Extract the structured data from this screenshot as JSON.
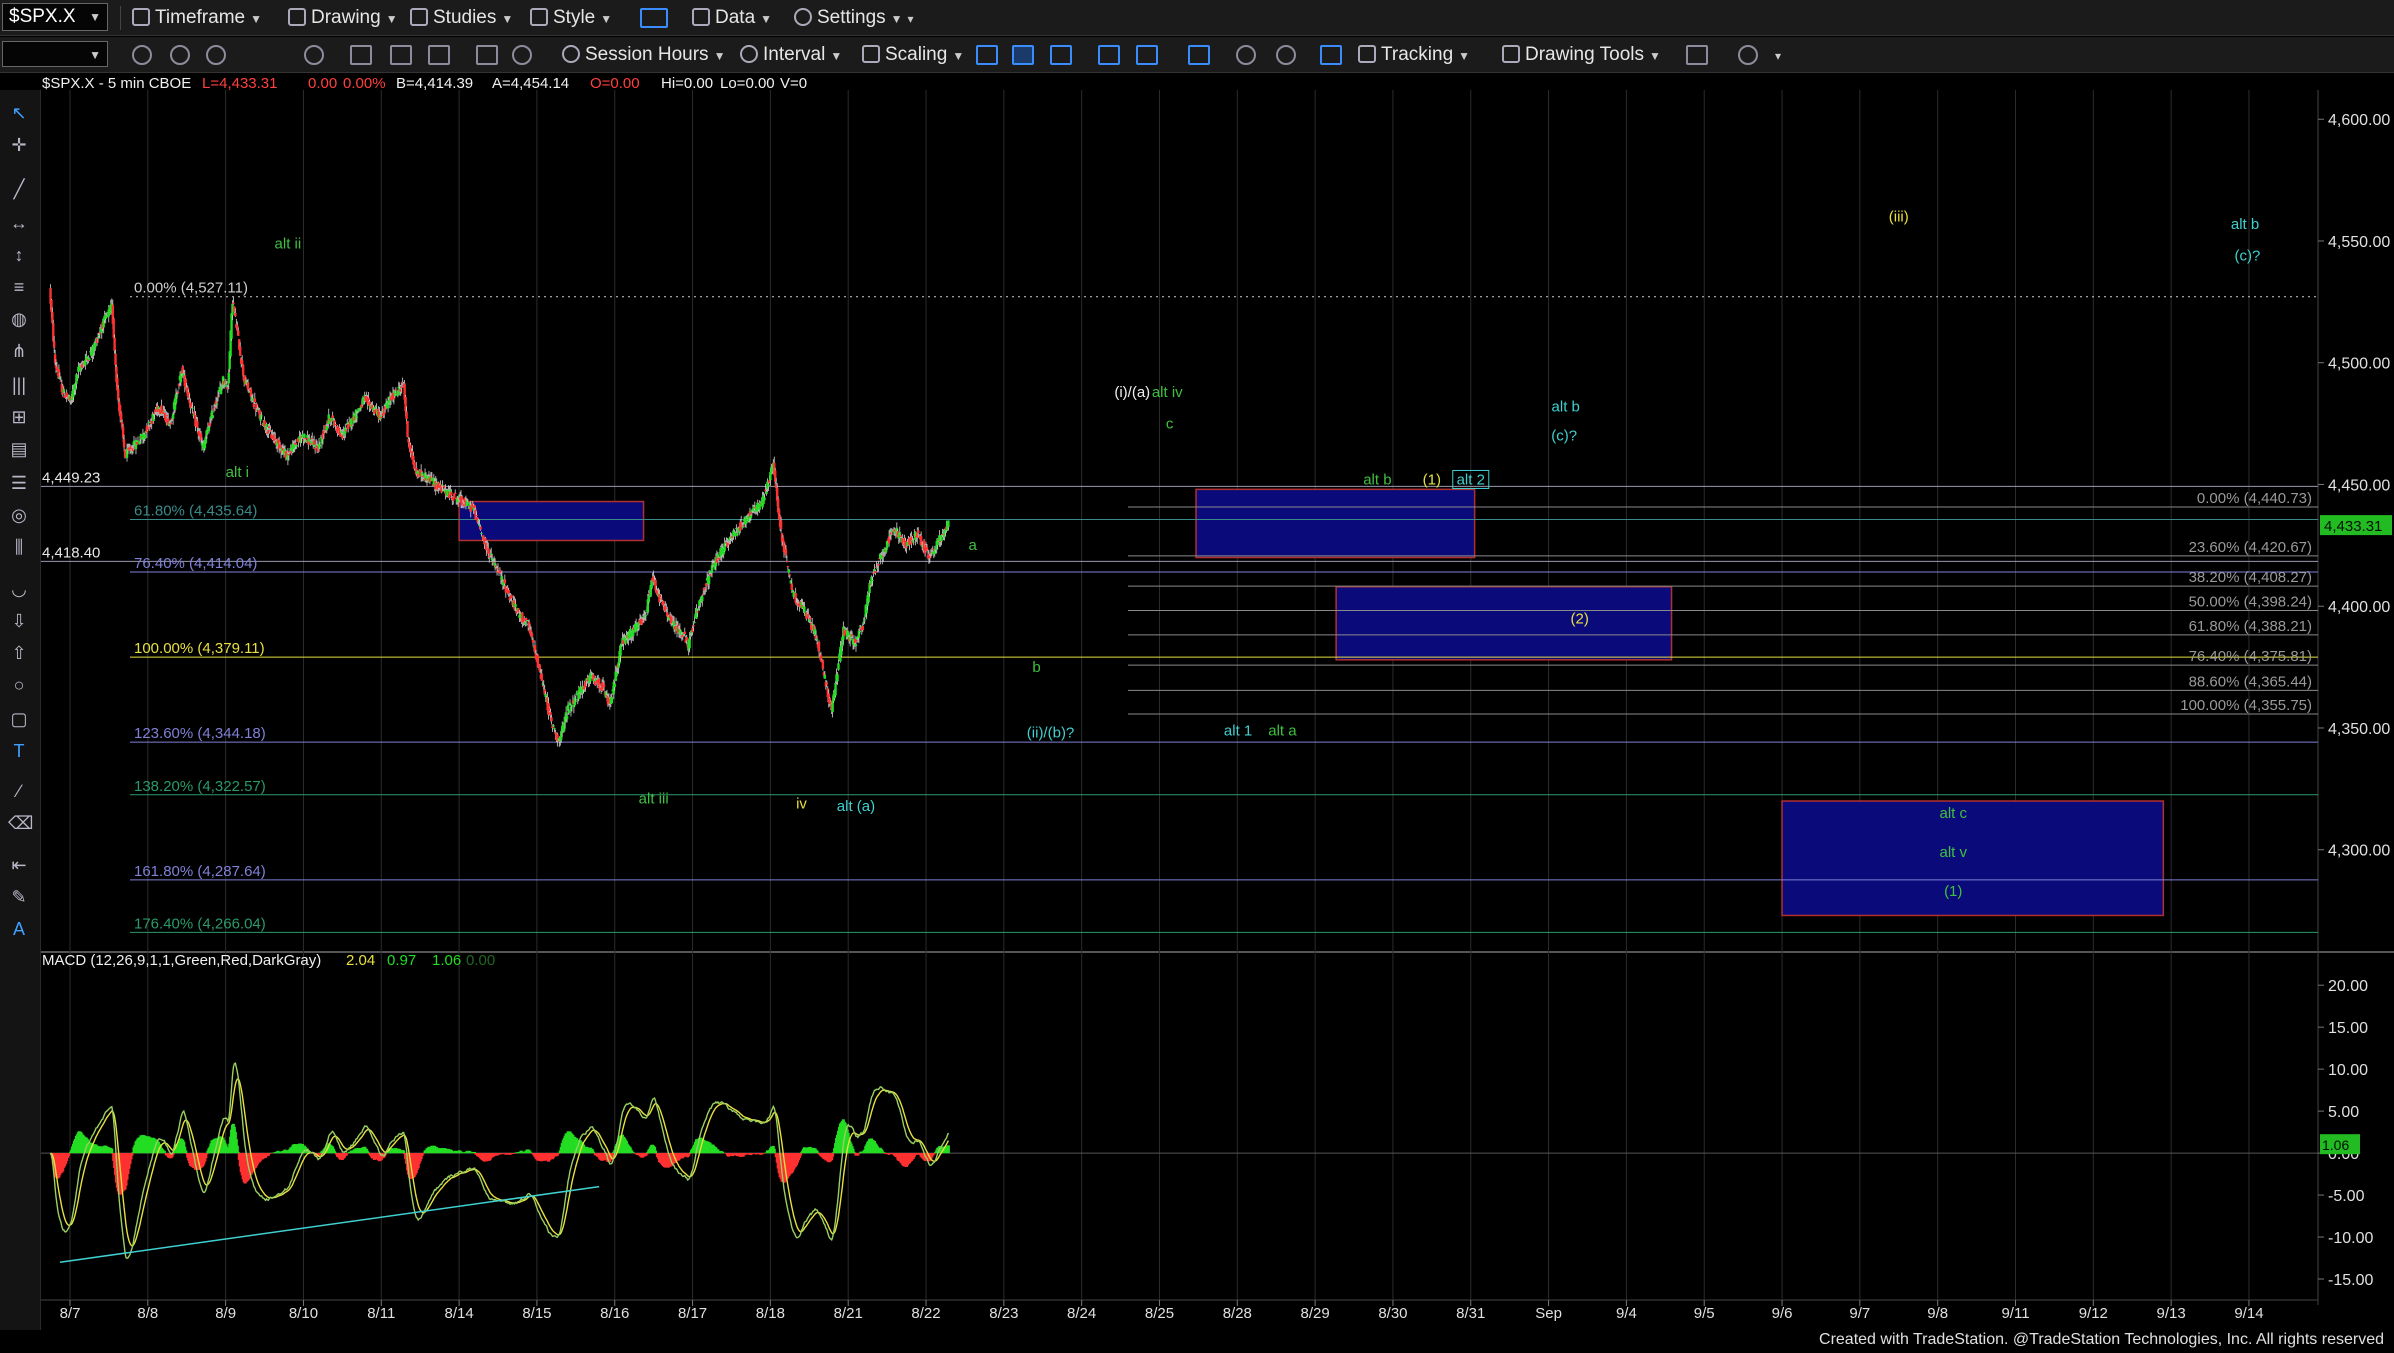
{
  "toolbar": {
    "symbol": "$SPX.X",
    "items": [
      "Timeframe",
      "Drawing",
      "Studies",
      "Style",
      "Data",
      "Settings"
    ],
    "row2": [
      "Session Hours",
      "Interval",
      "Scaling",
      "Tracking",
      "Drawing Tools"
    ]
  },
  "header": {
    "symbol_info": "$SPX.X - 5 min  CBOE",
    "low": "L=4,433.31",
    "change": "0.00",
    "change_pct": "0.00%",
    "bid": "B=4,414.39",
    "ask": "A=4,454.14",
    "open": "O=0.00",
    "hi": "Hi=0.00",
    "lo": "Lo=0.00",
    "vol": "V=0"
  },
  "macd": {
    "label": "MACD (12,26,9,1,1,Green,Red,DarkGray)",
    "v1": "2.04",
    "v2": "0.97",
    "v3": "1.06",
    "v4": "0.00"
  },
  "footer": "Created with TradeStation. @TradeStation Technologies, Inc. All rights reserved",
  "colors": {
    "background": "#000000",
    "up": "#22dd22",
    "down": "#ff3030",
    "wick": "#d8d8d8",
    "box_fill": "#0a0a7a",
    "box_edge": "#b03030",
    "green_label": "#40c040",
    "yellow_label": "#e8e040",
    "cyan_label": "#40d0d0",
    "white_label": "#f0f0f0"
  },
  "chart_data": {
    "type": "candlestick",
    "symbol": "$SPX.X",
    "interval": "5 min",
    "price_axis": {
      "ticks": [
        4600,
        4550,
        4500,
        4450,
        4400,
        4350,
        4300
      ],
      "tick_labels": [
        "4,600.00",
        "4,550.00",
        "4,500.00",
        "4,450.00",
        "4,400.00",
        "4,350.00",
        "4,300.00"
      ],
      "range": [
        4258,
        4612
      ],
      "last_price": "4,433.31"
    },
    "macd_axis": {
      "ticks": [
        20,
        15,
        10,
        5,
        0,
        -5,
        -10,
        -15
      ],
      "tick_labels": [
        "20.00",
        "15.00",
        "10.00",
        "5.00",
        "0.00",
        "-5.00",
        "-10.00",
        "-15.00"
      ],
      "range": [
        -17.5,
        23
      ],
      "last_value": "1.06"
    },
    "x_axis": {
      "labels": [
        "8/7",
        "8/8",
        "8/9",
        "8/10",
        "8/11",
        "8/14",
        "8/15",
        "8/16",
        "8/17",
        "8/18",
        "8/21",
        "8/22",
        "8/23",
        "8/24",
        "8/25",
        "8/28",
        "8/29",
        "8/30",
        "8/31",
        "Sep",
        "9/4",
        "9/5",
        "9/6",
        "9/7",
        "9/8",
        "9/11",
        "9/12",
        "9/13",
        "9/14"
      ],
      "session_index": [
        0,
        1,
        2,
        3,
        4,
        5,
        6,
        7,
        8,
        9,
        10,
        11,
        12,
        13,
        14,
        15,
        16,
        17,
        18,
        19,
        20,
        21,
        22,
        23,
        24,
        25,
        26,
        27,
        28
      ]
    },
    "price_path": [
      [
        -0.25,
        4530
      ],
      [
        -0.18,
        4500
      ],
      [
        -0.08,
        4488
      ],
      [
        0.02,
        4484
      ],
      [
        0.12,
        4497
      ],
      [
        0.3,
        4505
      ],
      [
        0.42,
        4515
      ],
      [
        0.55,
        4523
      ],
      [
        0.62,
        4488
      ],
      [
        0.72,
        4462
      ],
      [
        0.95,
        4470
      ],
      [
        1.15,
        4482
      ],
      [
        1.3,
        4475
      ],
      [
        1.45,
        4497
      ],
      [
        1.6,
        4478
      ],
      [
        1.72,
        4465
      ],
      [
        1.85,
        4480
      ],
      [
        1.98,
        4493
      ],
      [
        2.04,
        4490
      ],
      [
        2.1,
        4526
      ],
      [
        2.25,
        4493
      ],
      [
        2.45,
        4478
      ],
      [
        2.6,
        4470
      ],
      [
        2.8,
        4462
      ],
      [
        3.0,
        4470
      ],
      [
        3.2,
        4465
      ],
      [
        3.35,
        4478
      ],
      [
        3.5,
        4470
      ],
      [
        3.65,
        4477
      ],
      [
        3.8,
        4485
      ],
      [
        4.0,
        4478
      ],
      [
        4.15,
        4486
      ],
      [
        4.3,
        4491
      ],
      [
        4.35,
        4470
      ],
      [
        4.45,
        4455
      ],
      [
        4.6,
        4453
      ],
      [
        4.75,
        4449
      ],
      [
        4.9,
        4446
      ],
      [
        5.05,
        4443
      ],
      [
        5.2,
        4440
      ],
      [
        5.35,
        4425
      ],
      [
        5.5,
        4415
      ],
      [
        5.65,
        4405
      ],
      [
        5.75,
        4398
      ],
      [
        5.9,
        4392
      ],
      [
        6.0,
        4380
      ],
      [
        6.1,
        4366
      ],
      [
        6.2,
        4352
      ],
      [
        6.3,
        4344
      ],
      [
        6.4,
        4357
      ],
      [
        6.55,
        4364
      ],
      [
        6.7,
        4371
      ],
      [
        6.85,
        4367
      ],
      [
        6.95,
        4359
      ],
      [
        7.1,
        4385
      ],
      [
        7.25,
        4390
      ],
      [
        7.4,
        4395
      ],
      [
        7.5,
        4412
      ],
      [
        7.6,
        4402
      ],
      [
        7.75,
        4393
      ],
      [
        7.9,
        4388
      ],
      [
        7.95,
        4383
      ],
      [
        8.1,
        4402
      ],
      [
        8.3,
        4418
      ],
      [
        8.5,
        4428
      ],
      [
        8.7,
        4436
      ],
      [
        8.9,
        4442
      ],
      [
        9.05,
        4458
      ],
      [
        9.15,
        4430
      ],
      [
        9.3,
        4405
      ],
      [
        9.45,
        4398
      ],
      [
        9.6,
        4388
      ],
      [
        9.7,
        4372
      ],
      [
        9.8,
        4357
      ],
      [
        9.95,
        4390
      ],
      [
        10.1,
        4385
      ],
      [
        10.2,
        4392
      ],
      [
        10.3,
        4410
      ],
      [
        10.4,
        4418
      ],
      [
        10.5,
        4425
      ],
      [
        10.6,
        4432
      ],
      [
        10.75,
        4425
      ],
      [
        10.9,
        4430
      ],
      [
        11.05,
        4420
      ],
      [
        11.2,
        4428
      ],
      [
        11.3,
        4434
      ]
    ],
    "fib_left": [
      {
        "label": "0.00% (4,527.11)",
        "price": 4527.11,
        "color": "#cfcfcf",
        "dotted": true
      },
      {
        "label": "61.80% (4,435.64)",
        "price": 4435.64,
        "color": "#3a8a8a"
      },
      {
        "label": "76.40% (4,414.04)",
        "price": 4414.04,
        "color": "#8080d8"
      },
      {
        "label": "100.00% (4,379.11)",
        "price": 4379.11,
        "color": "#e8e040"
      },
      {
        "label": "123.60% (4,344.18)",
        "price": 4344.18,
        "color": "#8080d8"
      },
      {
        "label": "138.20% (4,322.57)",
        "price": 4322.57,
        "color": "#2a9a6a"
      },
      {
        "label": "161.80% (4,287.64)",
        "price": 4287.64,
        "color": "#8080d8"
      },
      {
        "label": "176.40% (4,266.04)",
        "price": 4266.04,
        "color": "#2a9a6a"
      }
    ],
    "fib_right": [
      {
        "label": "0.00% (4,440.73)",
        "price": 4440.73
      },
      {
        "label": "23.60% (4,420.67)",
        "price": 4420.67
      },
      {
        "label": "38.20% (4,408.27)",
        "price": 4408.27
      },
      {
        "label": "50.00% (4,398.24)",
        "price": 4398.24
      },
      {
        "label": "61.80% (4,388.21)",
        "price": 4388.21
      },
      {
        "label": "76.40% (4,375.81)",
        "price": 4375.81
      },
      {
        "label": "88.60% (4,365.44)",
        "price": 4365.44
      },
      {
        "label": "100.00% (4,355.75)",
        "price": 4355.75
      }
    ],
    "horizontal_levels": [
      {
        "label": "4,449.23",
        "price": 4449.23
      },
      {
        "label": "4,418.40",
        "price": 4418.4
      }
    ],
    "target_boxes": [
      {
        "name": "box-8-15",
        "x0": 5.0,
        "x1": 7.37,
        "p0": 4427,
        "p1": 4443
      },
      {
        "name": "box-alt-b",
        "x0": 14.47,
        "x1": 18.05,
        "p0": 4420,
        "p1": 4448
      },
      {
        "name": "box-2",
        "x0": 16.27,
        "x1": 20.58,
        "p0": 4378,
        "p1": 4408
      },
      {
        "name": "box-alt-c",
        "x0": 22.0,
        "x1": 26.9,
        "p0": 4273,
        "p1": 4320
      }
    ],
    "wave_labels": [
      {
        "text": "alt ii",
        "x": 2.8,
        "price": 4547,
        "color": "green"
      },
      {
        "text": "alt i",
        "x": 2.15,
        "price": 4453,
        "color": "green"
      },
      {
        "text": "alt iii",
        "x": 7.5,
        "price": 4319,
        "color": "green"
      },
      {
        "text": "iv",
        "x": 9.4,
        "price": 4317,
        "color": "yellow"
      },
      {
        "text": "alt (a)",
        "x": 10.1,
        "price": 4316,
        "color": "cyan"
      },
      {
        "text": "a",
        "x": 11.6,
        "price": 4423,
        "color": "green"
      },
      {
        "text": "b",
        "x": 12.42,
        "price": 4373,
        "color": "green"
      },
      {
        "text": "(ii)/(b)?",
        "x": 12.6,
        "price": 4346,
        "color": "cyan"
      },
      {
        "text": "(i)/(a)",
        "x": 13.65,
        "price": 4486,
        "color": "white"
      },
      {
        "text": "alt iv",
        "x": 14.1,
        "price": 4486,
        "color": "green"
      },
      {
        "text": "c",
        "x": 14.13,
        "price": 4473,
        "color": "green"
      },
      {
        "text": "alt 1",
        "x": 15.01,
        "price": 4347,
        "color": "cyan"
      },
      {
        "text": "alt a",
        "x": 15.58,
        "price": 4347,
        "color": "green"
      },
      {
        "text": "alt b",
        "x": 16.8,
        "price": 4450,
        "color": "green"
      },
      {
        "text": "(1)",
        "x": 17.5,
        "price": 4450,
        "color": "yellow"
      },
      {
        "text": "alt 2",
        "x": 18.0,
        "price": 4450,
        "color": "cyan"
      },
      {
        "text": "alt b",
        "x": 19.22,
        "price": 4480,
        "color": "cyan"
      },
      {
        "text": "(c)?",
        "x": 19.2,
        "price": 4468,
        "color": "cyan"
      },
      {
        "text": "(2)",
        "x": 19.4,
        "price": 4393,
        "color": "yellow"
      },
      {
        "text": "(iii)",
        "x": 23.5,
        "price": 4558,
        "color": "yellow"
      },
      {
        "text": "alt b",
        "x": 27.95,
        "price": 4555,
        "color": "cyan"
      },
      {
        "text": "(c)?",
        "x": 27.98,
        "price": 4542,
        "color": "cyan"
      },
      {
        "text": "alt c",
        "x": 24.2,
        "price": 4313,
        "color": "green"
      },
      {
        "text": "alt v",
        "x": 24.2,
        "price": 4297,
        "color": "green"
      },
      {
        "text": "(1)",
        "x": 24.2,
        "price": 4281,
        "color": "green"
      }
    ]
  }
}
